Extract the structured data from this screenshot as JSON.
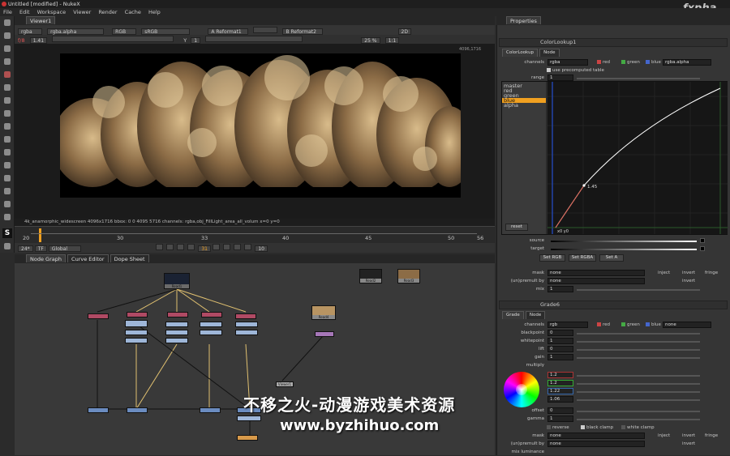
{
  "window": {
    "title": "Untitled [modified] - NukeX",
    "logo": "fxpha"
  },
  "menu": [
    "File",
    "Edit",
    "Workspace",
    "Viewer",
    "Render",
    "Cache",
    "Help"
  ],
  "viewer": {
    "tab": "Viewer1",
    "channels": "rgba",
    "layer": "rgba.alpha",
    "colorspace": "RGB",
    "display": "sRGB",
    "input_a": "A Reformat1",
    "input_b": "B Reformat2",
    "gain_label": "f/8",
    "gain_value": "1.41",
    "y_label": "Y",
    "y_value": "1",
    "mode": "2D",
    "zoom": "25 %",
    "ratio": "1:1",
    "res_top": "4096,1716",
    "info": "4k_anamorphic_widescreen 4096x1716  bbox: 0 0 4095 5716 channels: rgba,obj_FillLight_area_all_volum  x=0 y=0"
  },
  "timeline": {
    "ticks": [
      "20",
      "30",
      "33",
      "40",
      "45",
      "50",
      "56"
    ],
    "start": "20",
    "end": "56",
    "current_mark": "26",
    "fps": "24*",
    "tf": "TF",
    "scope": "Global",
    "frame": "31",
    "step": "10"
  },
  "dag": {
    "tabs": [
      "Node Graph",
      "Curve Editor",
      "Dope Sheet"
    ],
    "nodes": {
      "read1": "Read1",
      "read2": "Read2",
      "read3": "Read3",
      "read4": "Read4",
      "viewer": "Viewer1"
    }
  },
  "properties": {
    "tab": "Properties",
    "colorlookup": {
      "name": "ColorLookup1",
      "tabs": [
        "ColorLookup",
        "Node"
      ],
      "channels": "rgba",
      "channels_alpha": "rgba.alpha",
      "precomputed": "use precomputed table",
      "range_label": "range",
      "range_value": "1",
      "curves": [
        "master",
        "red",
        "green",
        "blue",
        "alpha"
      ],
      "selected": "blue",
      "point": "1.45",
      "point2": "x0 y0",
      "reset": "reset",
      "source": "source",
      "target": "target",
      "buttons": [
        "Set RGB",
        "Set RGBA",
        "Set A"
      ],
      "mask": "mask",
      "mask_val": "none",
      "inject": "inject",
      "invert": "invert",
      "fringe": "fringe",
      "unpremult": "(un)premult by",
      "unpremult_val": "none",
      "mix": "mix",
      "mix_val": "1"
    },
    "grade": {
      "name": "Grade6",
      "tabs": [
        "Grade",
        "Node"
      ],
      "channels": "rgb",
      "channels_extra": "none",
      "rows": [
        {
          "l": "blackpoint",
          "v": "0"
        },
        {
          "l": "whitepoint",
          "v": "1"
        },
        {
          "l": "lift",
          "v": "0"
        },
        {
          "l": "gain",
          "v": "1"
        }
      ],
      "multiply": "multiply",
      "mult_vals": [
        "1.2",
        "1.2",
        "1.22",
        "1.06"
      ],
      "offset": "offset",
      "offset_v": "0",
      "gamma": "gamma",
      "gamma_v": "1",
      "reverse": "reverse",
      "black_clamp": "black clamp",
      "white_clamp": "white clamp",
      "mask": "mask",
      "mask_val": "none",
      "unpremult": "(un)premult by",
      "unpremult_val": "none",
      "mix_lum": "mix luminance"
    }
  },
  "labels": {
    "red": "red",
    "green": "green",
    "blue": "blue",
    "channels": "channels"
  },
  "watermark": {
    "line1": "不移之火-动漫游戏美术资源",
    "line2": "www.byzhihuo.com"
  },
  "colors": {
    "accent": "#f0a020",
    "red": "#cc4444",
    "green": "#44aa44",
    "blue": "#4466cc"
  }
}
